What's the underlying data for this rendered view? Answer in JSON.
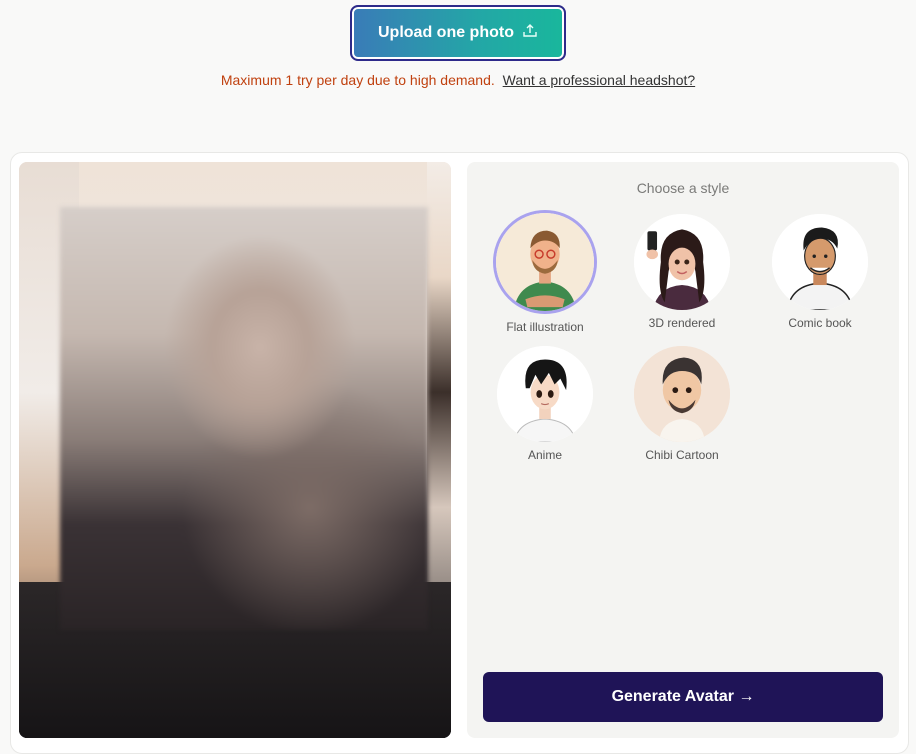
{
  "upload": {
    "label": "Upload one photo",
    "icon": "upload-icon"
  },
  "notice": {
    "text": "Maximum 1 try per day due to high demand.",
    "link": "Want a professional headshot?"
  },
  "style_picker": {
    "title": "Choose a style",
    "selected": "Flat illustration",
    "options": [
      {
        "label": "Flat illustration"
      },
      {
        "label": "3D rendered"
      },
      {
        "label": "Comic book"
      },
      {
        "label": "Anime"
      },
      {
        "label": "Chibi Cartoon"
      }
    ]
  },
  "generate": {
    "label": "Generate Avatar →"
  },
  "colors": {
    "notice_text": "#c0410f",
    "generate_bg": "#1f1457",
    "selected_ring": "#a9a2ee",
    "upload_gradient_start": "#3a7bb8",
    "upload_gradient_end": "#19b79c"
  }
}
